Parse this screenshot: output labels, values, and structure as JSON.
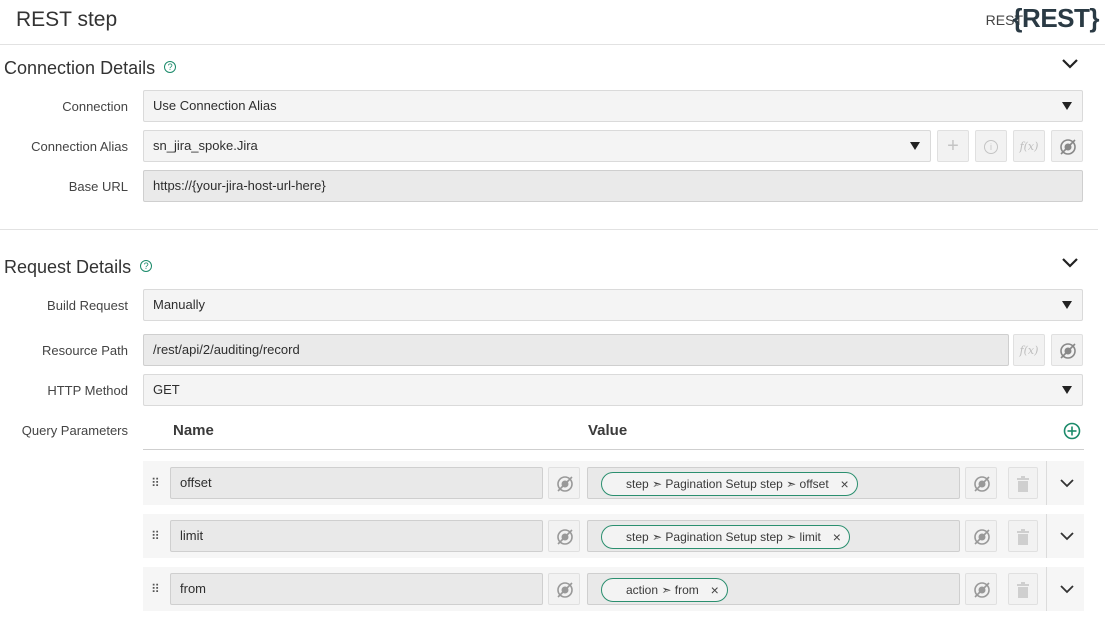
{
  "header": {
    "title": "REST step",
    "step_type": "REST",
    "logo": "{REST}"
  },
  "connection_details": {
    "title": "Connection Details",
    "fields": {
      "connection": {
        "label": "Connection",
        "value": "Use Connection Alias"
      },
      "connection_alias": {
        "label": "Connection Alias",
        "value": "sn_jira_spoke.Jira"
      },
      "base_url": {
        "label": "Base URL",
        "value": "https://{your-jira-host-url-here}"
      }
    }
  },
  "request_details": {
    "title": "Request Details",
    "fields": {
      "build_request": {
        "label": "Build Request",
        "value": "Manually"
      },
      "resource_path": {
        "label": "Resource Path",
        "value": "/rest/api/2/auditing/record"
      },
      "http_method": {
        "label": "HTTP Method",
        "value": "GET"
      }
    },
    "query_parameters": {
      "label": "Query Parameters",
      "columns": {
        "name": "Name",
        "value": "Value"
      },
      "rows": [
        {
          "name": "offset",
          "value": "step ➣ Pagination Setup step ➣ offset"
        },
        {
          "name": "limit",
          "value": "step ➣ Pagination Setup step ➣ limit"
        },
        {
          "name": "from",
          "value": "action ➣ from"
        }
      ]
    }
  },
  "icons": {
    "help": "?",
    "add": "+",
    "info": "i",
    "fx": "f(x)",
    "remove": "×",
    "drag": "⠿"
  },
  "colors": {
    "accent": "#1b8a6a",
    "pill_border": "#2b8f6f"
  }
}
